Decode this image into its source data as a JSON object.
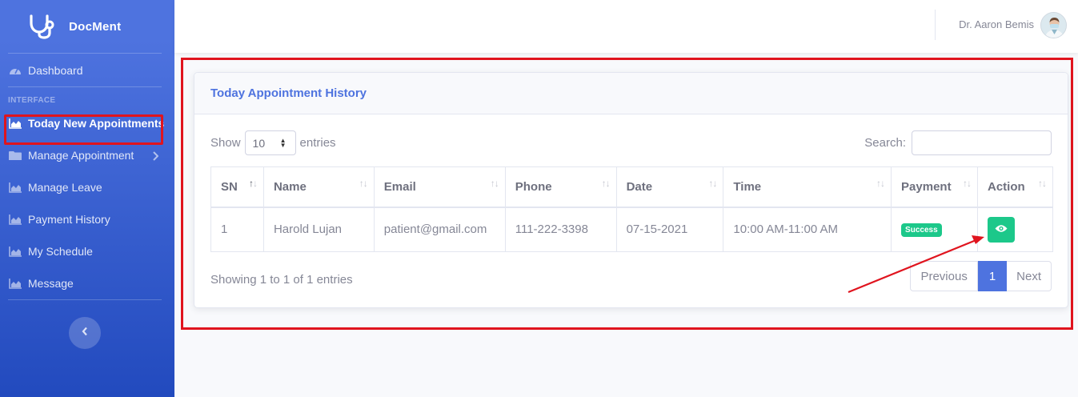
{
  "brand": {
    "name": "DocMent"
  },
  "sidebar": {
    "items": [
      {
        "label": "Dashboard",
        "icon": "dashboard-icon"
      },
      {
        "label": "Today New Appointments",
        "icon": "chart-area-icon"
      },
      {
        "label": "Manage Appointment",
        "icon": "folder-icon"
      },
      {
        "label": "Manage Leave",
        "icon": "chart-area-icon"
      },
      {
        "label": "Payment History",
        "icon": "chart-area-icon"
      },
      {
        "label": "My Schedule",
        "icon": "chart-area-icon"
      },
      {
        "label": "Message",
        "icon": "chart-area-icon"
      }
    ],
    "heading": "INTERFACE"
  },
  "topbar": {
    "user_name": "Dr. Aaron Bemis"
  },
  "card": {
    "title": "Today Appointment History",
    "show_label": "Show",
    "entries_label": "entries",
    "page_length": "10",
    "search_label": "Search:",
    "search_value": "",
    "info": "Showing 1 to 1 of 1 entries"
  },
  "table": {
    "columns": [
      "SN",
      "Name",
      "Email",
      "Phone",
      "Date",
      "Time",
      "Payment",
      "Action"
    ],
    "rows": [
      {
        "sn": "1",
        "name": "Harold Lujan",
        "email": "patient@gmail.com",
        "phone": "111-222-3398",
        "date": "07-15-2021",
        "time": "10:00 AM-11:00 AM",
        "payment": "Success"
      }
    ]
  },
  "pagination": {
    "previous": "Previous",
    "current": "1",
    "next": "Next"
  },
  "colors": {
    "primary": "#4e73df",
    "success": "#1cc88a",
    "highlight": "#e0141e"
  }
}
